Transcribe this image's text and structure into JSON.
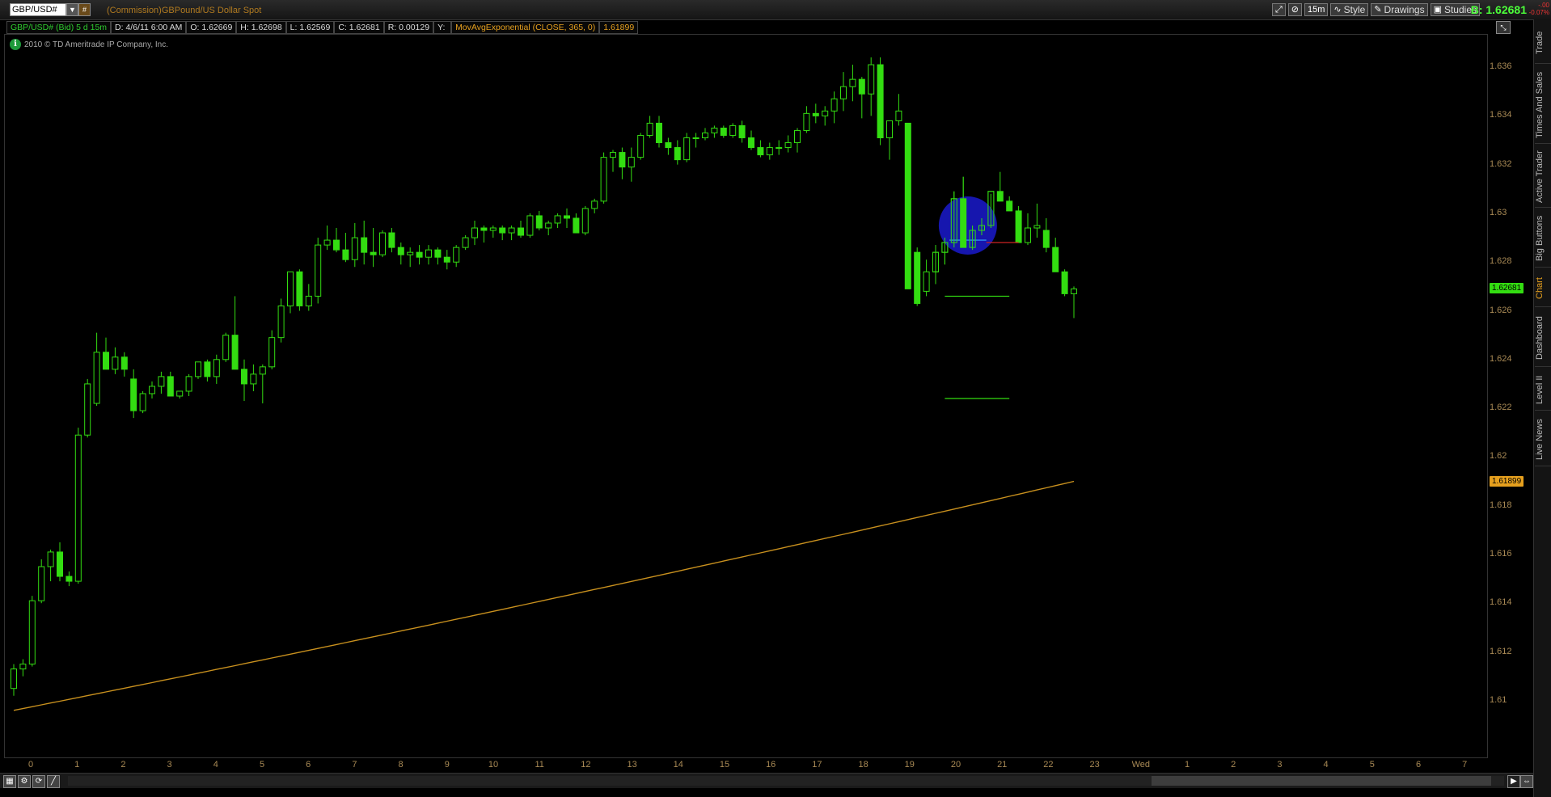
{
  "toolbar": {
    "symbol": "GBP/USD#",
    "commission_text": "(Commission)GBPound/US Dollar Spot",
    "interval_button": "15m",
    "style_label": "Style",
    "drawings_label": "Drawings",
    "studies_label": "Studies",
    "bid_text": "B: 1.62681",
    "change_top": "-.00",
    "change_bottom": "-0.07%"
  },
  "info_bar": {
    "symbol_period": "GBP/USD# (Bid) 5 d 15m",
    "date": "D: 4/6/11 6:00 AM",
    "open": "O: 1.62669",
    "high": "H: 1.62698",
    "low": "L: 1.62569",
    "close": "C: 1.62681",
    "range": "R: 0.00129",
    "y": "Y:",
    "study_name": "MovAvgExponential (CLOSE, 365, 0)",
    "study_value": "1.61899"
  },
  "copyright": "2010 © TD Ameritrade IP Company, Inc.",
  "side_tabs": [
    "Trade",
    "Times And Sales",
    "Active Trader",
    "Big Buttons",
    "Chart",
    "Dashboard",
    "Level II",
    "Live News"
  ],
  "price_tags": {
    "last": "1.62681",
    "ema": "1.61899"
  },
  "colors": {
    "up": "#33dd11",
    "ema": "#c8901e",
    "accent": "#e6a01e",
    "bid": "#4cff3a",
    "highlight": "#1a1acc"
  },
  "chart_data": {
    "type": "candlestick",
    "title": "GBP/USD# (Bid) 5 d 15m",
    "ylim": [
      1.6085,
      1.6365
    ],
    "y_ticks": [
      "1.636",
      "1.634",
      "1.632",
      "1.63",
      "1.628",
      "1.626",
      "1.624",
      "1.622",
      "1.62",
      "1.618",
      "1.616",
      "1.614",
      "1.612",
      "1.61"
    ],
    "x_ticks": [
      "0",
      "1",
      "2",
      "3",
      "4",
      "5",
      "6",
      "7",
      "8",
      "9",
      "10",
      "11",
      "12",
      "13",
      "14",
      "15",
      "16",
      "17",
      "18",
      "19",
      "20",
      "21",
      "22",
      "23",
      "Wed",
      "1",
      "2",
      "3",
      "4",
      "5",
      "6",
      "7"
    ],
    "candles": [
      [
        1.6105,
        1.6115,
        1.6102,
        1.6113
      ],
      [
        1.6113,
        1.6117,
        1.611,
        1.6115
      ],
      [
        1.6115,
        1.6143,
        1.6114,
        1.6141
      ],
      [
        1.6141,
        1.6158,
        1.614,
        1.6155
      ],
      [
        1.6155,
        1.6162,
        1.6149,
        1.6161
      ],
      [
        1.6161,
        1.6165,
        1.6149,
        1.6151
      ],
      [
        1.6151,
        1.6153,
        1.6147,
        1.6149
      ],
      [
        1.6149,
        1.6212,
        1.6148,
        1.6209
      ],
      [
        1.6209,
        1.6232,
        1.6208,
        1.623
      ],
      [
        1.6222,
        1.6251,
        1.6221,
        1.6243
      ],
      [
        1.6243,
        1.6249,
        1.6236,
        1.6236
      ],
      [
        1.6236,
        1.6245,
        1.6234,
        1.6241
      ],
      [
        1.6241,
        1.6243,
        1.6233,
        1.6236
      ],
      [
        1.6232,
        1.6236,
        1.6216,
        1.6219
      ],
      [
        1.6219,
        1.6227,
        1.6218,
        1.6226
      ],
      [
        1.6226,
        1.6231,
        1.6224,
        1.6229
      ],
      [
        1.6229,
        1.6235,
        1.6226,
        1.6233
      ],
      [
        1.6233,
        1.6235,
        1.6225,
        1.6225
      ],
      [
        1.6225,
        1.6227,
        1.6224,
        1.6227
      ],
      [
        1.6227,
        1.6234,
        1.6225,
        1.6233
      ],
      [
        1.6233,
        1.6239,
        1.6232,
        1.6239
      ],
      [
        1.6239,
        1.624,
        1.6231,
        1.6233
      ],
      [
        1.6233,
        1.6242,
        1.623,
        1.624
      ],
      [
        1.624,
        1.6251,
        1.6239,
        1.625
      ],
      [
        1.625,
        1.6266,
        1.6236,
        1.6236
      ],
      [
        1.6236,
        1.624,
        1.6223,
        1.623
      ],
      [
        1.623,
        1.6238,
        1.6227,
        1.6234
      ],
      [
        1.6234,
        1.6238,
        1.6222,
        1.6237
      ],
      [
        1.6237,
        1.6252,
        1.6236,
        1.6249
      ],
      [
        1.6249,
        1.6265,
        1.6247,
        1.6262
      ],
      [
        1.6262,
        1.6271,
        1.6259,
        1.6276
      ],
      [
        1.6276,
        1.6277,
        1.626,
        1.6262
      ],
      [
        1.6262,
        1.6271,
        1.626,
        1.6266
      ],
      [
        1.6266,
        1.629,
        1.6263,
        1.6287
      ],
      [
        1.6287,
        1.6295,
        1.6285,
        1.6289
      ],
      [
        1.6289,
        1.6294,
        1.6284,
        1.6285
      ],
      [
        1.6285,
        1.6292,
        1.628,
        1.6281
      ],
      [
        1.6281,
        1.6296,
        1.6278,
        1.629
      ],
      [
        1.629,
        1.6297,
        1.6279,
        1.6284
      ],
      [
        1.6284,
        1.6294,
        1.6278,
        1.6283
      ],
      [
        1.6283,
        1.6293,
        1.6282,
        1.6292
      ],
      [
        1.6292,
        1.6294,
        1.6284,
        1.6286
      ],
      [
        1.6286,
        1.6288,
        1.6279,
        1.6283
      ],
      [
        1.6283,
        1.6286,
        1.6278,
        1.6284
      ],
      [
        1.6284,
        1.6287,
        1.6279,
        1.6282
      ],
      [
        1.6282,
        1.6287,
        1.6279,
        1.6285
      ],
      [
        1.6285,
        1.6286,
        1.6279,
        1.6282
      ],
      [
        1.6282,
        1.6285,
        1.6277,
        1.628
      ],
      [
        1.628,
        1.6287,
        1.6278,
        1.6286
      ],
      [
        1.6286,
        1.6291,
        1.6285,
        1.629
      ],
      [
        1.629,
        1.6297,
        1.6287,
        1.6294
      ],
      [
        1.6294,
        1.6295,
        1.6288,
        1.6293
      ],
      [
        1.6293,
        1.6295,
        1.629,
        1.6294
      ],
      [
        1.6294,
        1.6295,
        1.6289,
        1.6292
      ],
      [
        1.6292,
        1.6295,
        1.6289,
        1.6294
      ],
      [
        1.6294,
        1.6297,
        1.629,
        1.6291
      ],
      [
        1.6291,
        1.63,
        1.629,
        1.6299
      ],
      [
        1.6299,
        1.6301,
        1.6293,
        1.6294
      ],
      [
        1.6294,
        1.6297,
        1.6291,
        1.6296
      ],
      [
        1.6296,
        1.63,
        1.6294,
        1.6299
      ],
      [
        1.6299,
        1.6302,
        1.6294,
        1.6298
      ],
      [
        1.6298,
        1.63,
        1.6293,
        1.6292
      ],
      [
        1.6292,
        1.6303,
        1.6291,
        1.6302
      ],
      [
        1.6302,
        1.6306,
        1.63,
        1.6305
      ],
      [
        1.6305,
        1.6325,
        1.6304,
        1.6323
      ],
      [
        1.6323,
        1.6326,
        1.6317,
        1.6325
      ],
      [
        1.6325,
        1.6327,
        1.6314,
        1.6319
      ],
      [
        1.6319,
        1.6327,
        1.6313,
        1.6323
      ],
      [
        1.6323,
        1.6333,
        1.6322,
        1.6332
      ],
      [
        1.6332,
        1.634,
        1.6331,
        1.6337
      ],
      [
        1.6337,
        1.634,
        1.6327,
        1.6329
      ],
      [
        1.6329,
        1.6331,
        1.6324,
        1.6327
      ],
      [
        1.6327,
        1.633,
        1.632,
        1.6322
      ],
      [
        1.6322,
        1.6333,
        1.6321,
        1.6331
      ],
      [
        1.6331,
        1.6333,
        1.6327,
        1.6331
      ],
      [
        1.6331,
        1.6335,
        1.633,
        1.6333
      ],
      [
        1.6333,
        1.6336,
        1.6331,
        1.6335
      ],
      [
        1.6335,
        1.6336,
        1.6331,
        1.6332
      ],
      [
        1.6332,
        1.6337,
        1.6331,
        1.6336
      ],
      [
        1.6336,
        1.6338,
        1.6329,
        1.6331
      ],
      [
        1.6331,
        1.6334,
        1.6326,
        1.6327
      ],
      [
        1.6327,
        1.633,
        1.6323,
        1.6324
      ],
      [
        1.6324,
        1.6329,
        1.6322,
        1.6327
      ],
      [
        1.6327,
        1.633,
        1.6324,
        1.6327
      ],
      [
        1.6327,
        1.6332,
        1.6325,
        1.6329
      ],
      [
        1.6329,
        1.6335,
        1.6325,
        1.6334
      ],
      [
        1.6334,
        1.6344,
        1.6333,
        1.6341
      ],
      [
        1.6341,
        1.6345,
        1.6337,
        1.634
      ],
      [
        1.634,
        1.6344,
        1.6336,
        1.6342
      ],
      [
        1.6342,
        1.635,
        1.6337,
        1.6347
      ],
      [
        1.6347,
        1.6358,
        1.6342,
        1.6352
      ],
      [
        1.6352,
        1.6361,
        1.6346,
        1.6355
      ],
      [
        1.6355,
        1.6356,
        1.6339,
        1.6349
      ],
      [
        1.6349,
        1.6364,
        1.634,
        1.6361
      ],
      [
        1.6361,
        1.6364,
        1.6328,
        1.6331
      ],
      [
        1.6331,
        1.6338,
        1.6322,
        1.6338
      ],
      [
        1.6338,
        1.6349,
        1.6336,
        1.6342
      ],
      [
        1.6337,
        1.6337,
        1.6269,
        1.6269
      ],
      [
        1.6284,
        1.6286,
        1.6262,
        1.6263
      ],
      [
        1.6268,
        1.6281,
        1.6266,
        1.6276
      ],
      [
        1.6276,
        1.6287,
        1.6271,
        1.6284
      ],
      [
        1.6284,
        1.629,
        1.6279,
        1.6288
      ],
      [
        1.6288,
        1.6309,
        1.6286,
        1.6306
      ],
      [
        1.6306,
        1.6315,
        1.6286,
        1.6286
      ],
      [
        1.6286,
        1.6295,
        1.6285,
        1.6293
      ],
      [
        1.6293,
        1.6298,
        1.6291,
        1.6295
      ],
      [
        1.6295,
        1.6308,
        1.6294,
        1.6309
      ],
      [
        1.6309,
        1.6317,
        1.6306,
        1.6305
      ],
      [
        1.6305,
        1.6307,
        1.6302,
        1.6301
      ],
      [
        1.6301,
        1.6303,
        1.6288,
        1.6288
      ],
      [
        1.6288,
        1.63,
        1.6287,
        1.6294
      ],
      [
        1.6294,
        1.6304,
        1.629,
        1.6295
      ],
      [
        1.6293,
        1.6298,
        1.6284,
        1.6286
      ],
      [
        1.6286,
        1.629,
        1.6277,
        1.6276
      ],
      [
        1.6276,
        1.6277,
        1.6266,
        1.6267
      ],
      [
        1.6267,
        1.627,
        1.6257,
        1.6269
      ]
    ],
    "ema": {
      "name": "MovAvgExponential (CLOSE, 365, 0)",
      "start": 1.6096,
      "end": 1.619
    },
    "annotations": {
      "highlight_circle": {
        "center_bar": 103.5,
        "price": 1.6295
      },
      "lines": [
        {
          "price": 1.6289,
          "from_bar": 101.5,
          "to_bar": 105.5,
          "color": "#33aaff"
        },
        {
          "price": 1.6288,
          "from_bar": 105.5,
          "to_bar": 109,
          "color": "#cc2222"
        },
        {
          "price": 1.6266,
          "from_bar": 101,
          "to_bar": 108,
          "color": "#33dd11"
        },
        {
          "price": 1.6224,
          "from_bar": 101,
          "to_bar": 108,
          "color": "#33dd11"
        }
      ]
    }
  }
}
